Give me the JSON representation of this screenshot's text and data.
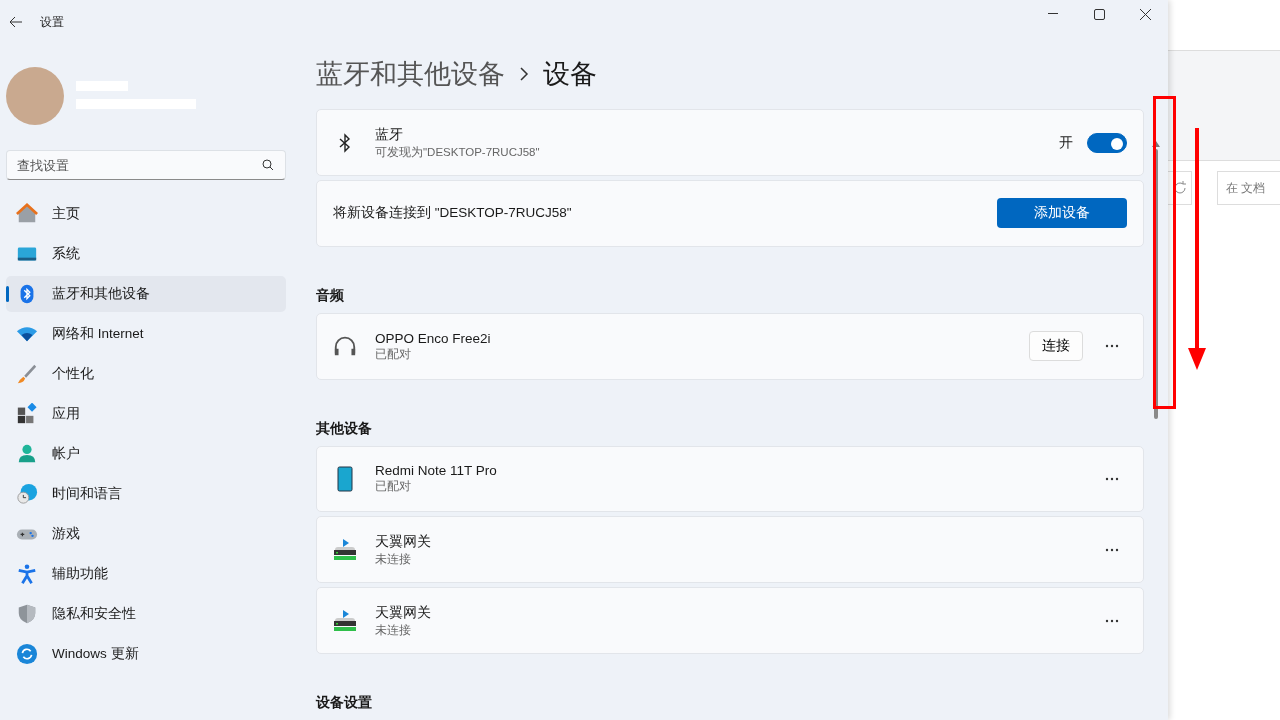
{
  "window": {
    "title": "设置"
  },
  "search": {
    "placeholder": "查找设置"
  },
  "nav": [
    {
      "label": "主页",
      "kind": "home",
      "selected": false
    },
    {
      "label": "系统",
      "kind": "system",
      "selected": false
    },
    {
      "label": "蓝牙和其他设备",
      "kind": "bluetooth",
      "selected": true
    },
    {
      "label": "网络和 Internet",
      "kind": "wifi",
      "selected": false
    },
    {
      "label": "个性化",
      "kind": "brush",
      "selected": false
    },
    {
      "label": "应用",
      "kind": "apps",
      "selected": false
    },
    {
      "label": "帐户",
      "kind": "person",
      "selected": false
    },
    {
      "label": "时间和语言",
      "kind": "globe",
      "selected": false
    },
    {
      "label": "游戏",
      "kind": "gamepad",
      "selected": false
    },
    {
      "label": "辅助功能",
      "kind": "accessibility",
      "selected": false
    },
    {
      "label": "隐私和安全性",
      "kind": "shield",
      "selected": false
    },
    {
      "label": "Windows 更新",
      "kind": "update",
      "selected": false
    }
  ],
  "breadcrumb": [
    "蓝牙和其他设备",
    "设备"
  ],
  "bluetooth": {
    "title": "蓝牙",
    "subtitle": "可发现为\"DESKTOP-7RUCJ58\"",
    "state_label": "开",
    "on": true
  },
  "add_device": {
    "text": "将新设备连接到 \"DESKTOP-7RUCJ58\"",
    "button": "添加设备"
  },
  "sections": [
    {
      "title": "音频",
      "devices": [
        {
          "name": "OPPO Enco Free2i",
          "status": "已配对",
          "kind": "headphones",
          "action": "连接"
        }
      ]
    },
    {
      "title": "其他设备",
      "devices": [
        {
          "name": "Redmi Note 11T Pro",
          "status": "已配对",
          "kind": "phone"
        },
        {
          "name": "天翼网关",
          "status": "未连接",
          "kind": "gateway"
        },
        {
          "name": "天翼网关",
          "status": "未连接",
          "kind": "gateway"
        }
      ]
    },
    {
      "title": "设备设置"
    }
  ],
  "background_window": {
    "search_placeholder": "在 文档"
  }
}
